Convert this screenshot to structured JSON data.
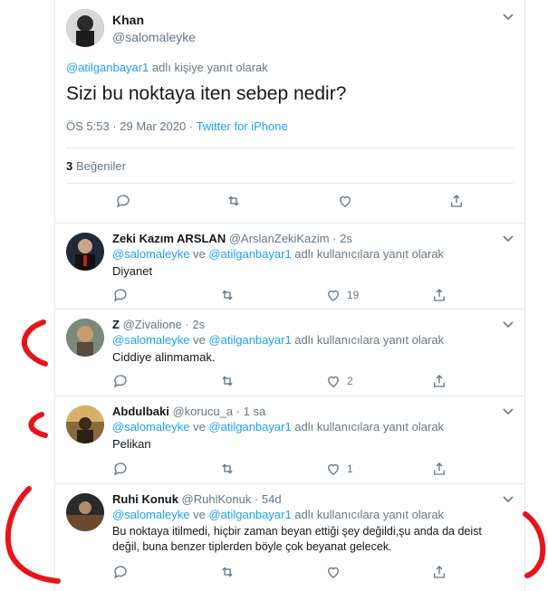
{
  "main_tweet": {
    "author_name": "Khan",
    "author_handle": "@salomaleyke",
    "replying_to_link": "@atilganbayar1",
    "replying_to_suffix": " adlı kişiye yanıt olarak",
    "text": "Sizi bu noktaya iten sebep nedir?",
    "time": "ÖS 5:53 · 29 Mar 2020 · ",
    "source": "Twitter for iPhone",
    "likes_count": "3",
    "likes_label": "Beğeniler",
    "more_icon": "chevron-down-icon"
  },
  "replies": [
    {
      "name": "Zeki Kazım ARSLAN",
      "handle_time": " @ArslanZekiKazim · 2s",
      "replying_link1": "@salomaleyke",
      "replying_mid": " ve ",
      "replying_link2": "@atilganbayar1",
      "replying_suffix": " adlı kullanıcılara yanıt olarak",
      "text": "Diyanet",
      "likes": "19"
    },
    {
      "name": "Z",
      "handle_time": " @Zivalione · 2s",
      "replying_link1": "@salomaleyke",
      "replying_mid": " ve ",
      "replying_link2": "@atilganbayar1",
      "replying_suffix": " adlı kullanıcılara yanıt olarak",
      "text": "Ciddiye alinmamak.",
      "likes": "2"
    },
    {
      "name": "Abdulbaki",
      "handle_time": " @korucu_a · 1 sa",
      "replying_link1": "@salomaleyke",
      "replying_mid": " ve ",
      "replying_link2": "@atilganbayar1",
      "replying_suffix": " adlı kullanıcılara yanıt olarak",
      "text": "Pelikan",
      "likes": "1"
    },
    {
      "name": "Ruhi Konuk",
      "handle_time": " @RuhiKonuk · 54d",
      "replying_link1": "@salomaleyke",
      "replying_mid": " ve ",
      "replying_link2": "@atilganbayar1",
      "replying_suffix": " adlı kullanıcılara yanıt olarak",
      "text": "Bu noktaya itilmedi, hiçbir zaman beyan ettiği şey değildi,şu anda da deist değil, buna benzer tiplerden böyle çok beyanat gelecek.",
      "likes": ""
    }
  ],
  "colors": {
    "link": "#1da1f2",
    "muted": "#657786",
    "annotation": "#e8141b"
  }
}
